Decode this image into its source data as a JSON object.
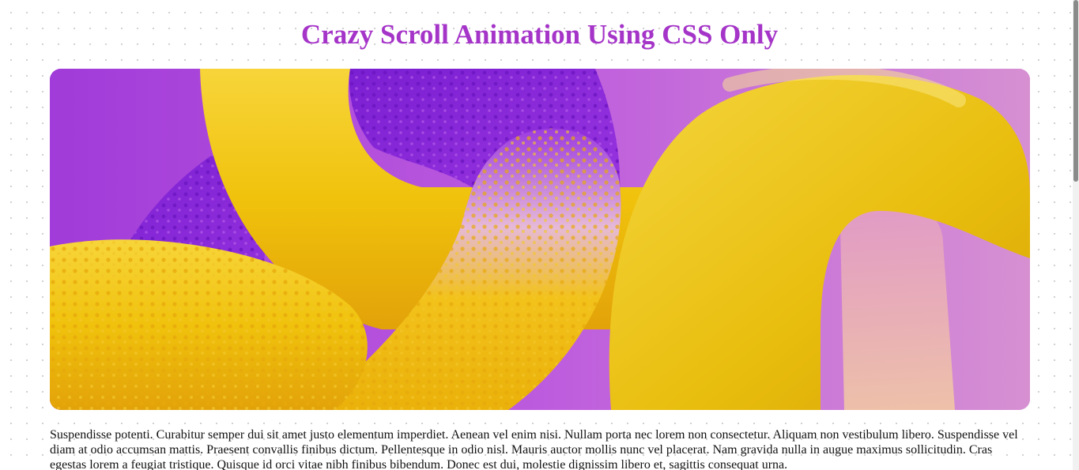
{
  "page": {
    "title": "Crazy Scroll Animation Using CSS Only",
    "hero_image": {
      "description_icon": "abstract-3d-tubes-image",
      "colors": {
        "purple": "#a534c8",
        "yellow": "#f2c20b",
        "pink": "#d98fd2"
      }
    },
    "paragraph": "Suspendisse potenti. Curabitur semper dui sit amet justo elementum imperdiet. Aenean vel enim nisi. Nullam porta nec lorem non consectetur. Aliquam non vestibulum libero. Suspendisse vel diam at odio accumsan mattis. Praesent convallis finibus dictum. Pellentesque in odio nisl. Mauris auctor mollis nunc vel placerat. Nam gravida nulla in augue maximus sollicitudin. Cras egestas lorem a feugiat tristique. Quisque id orci vitae nibh finibus bibendum. Donec est dui, molestie dignissim libero et, sagittis consequat urna."
  },
  "scrollbar": {
    "position_fraction": 0.0
  }
}
